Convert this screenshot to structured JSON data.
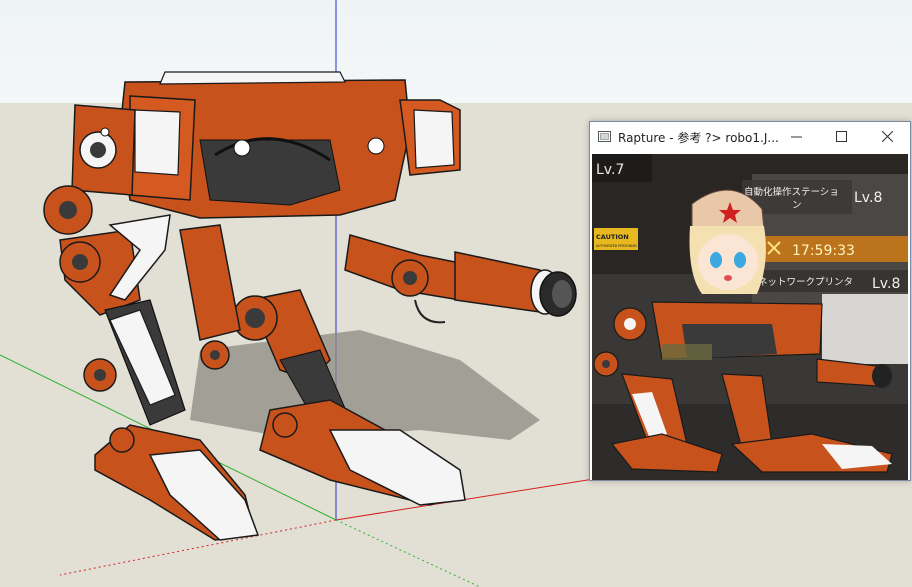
{
  "window": {
    "title": "Rapture - 参考 ?> robo1.J...",
    "controls": [
      "minimize-icon",
      "maximize-icon",
      "close-icon"
    ]
  },
  "game": {
    "level_top_left": "Lv.7",
    "station_label_line1": "自動化操作ステーショ",
    "station_label_line2": "ン",
    "station_level": "Lv.8",
    "timer": "17:59:33",
    "printer_label": "ネットワークプリンタ",
    "printer_level": "Lv.8",
    "caution_title": "CAUTION",
    "caution_sub": "AUTHORIZED PERSONNEL"
  },
  "colors": {
    "robot_orange": "#c8521c",
    "robot_dark": "#3a3a3a",
    "sky": "#eef3f6",
    "ground": "#e2dfd4",
    "axis_blue": "#2830c8",
    "axis_red": "#d42020",
    "axis_green": "#30b030"
  }
}
